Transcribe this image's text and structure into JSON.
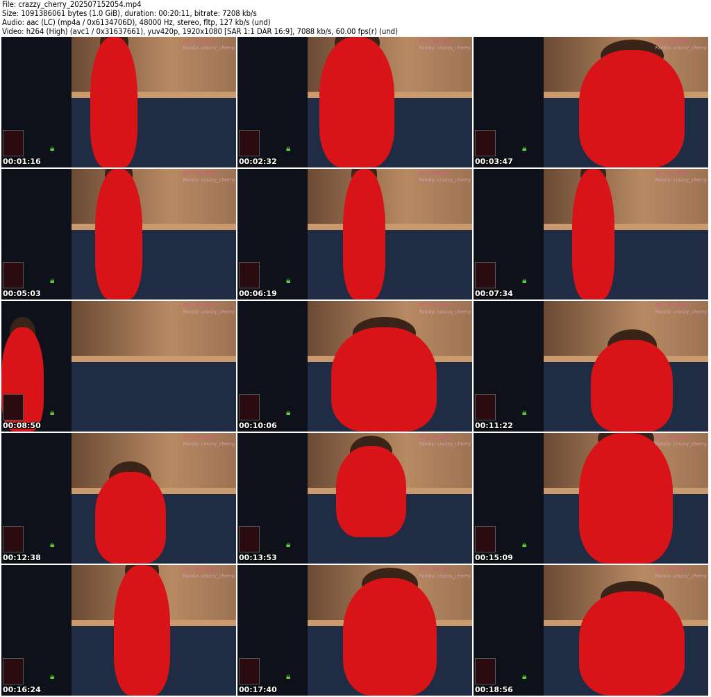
{
  "header": {
    "file": "File: crazzy_cherry_202507152054.mp4",
    "size": "Size: 1091386061 bytes (1.0 GiB), duration: 00:20:11, bitrate: 7208 kb/s",
    "audio": "Audio: aac (LC) (mp4a / 0x6134706D), 48000 Hz, stereo, fltp, 127 kb/s (und)",
    "video": "Video: h264 (High) (avc1 / 0x31637661), yuv420p, 1920x1080 [SAR 1:1 DAR 16:9], 7088 kb/s, 60.00 fps(r) (und)"
  },
  "overlay": {
    "ig": "IG: i_am_Julsi",
    "fansly": "Fansly: crazzy_cherry"
  },
  "thumbnails": [
    "00:01:16",
    "00:02:32",
    "00:03:47",
    "00:05:03",
    "00:06:19",
    "00:07:34",
    "00:08:50",
    "00:10:06",
    "00:11:22",
    "00:12:38",
    "00:13:53",
    "00:15:09",
    "00:16:24",
    "00:17:40",
    "00:18:56"
  ],
  "colors": {
    "dress": "#d81418",
    "timestamp": "#ffffff",
    "watermark": "#e0508a"
  }
}
